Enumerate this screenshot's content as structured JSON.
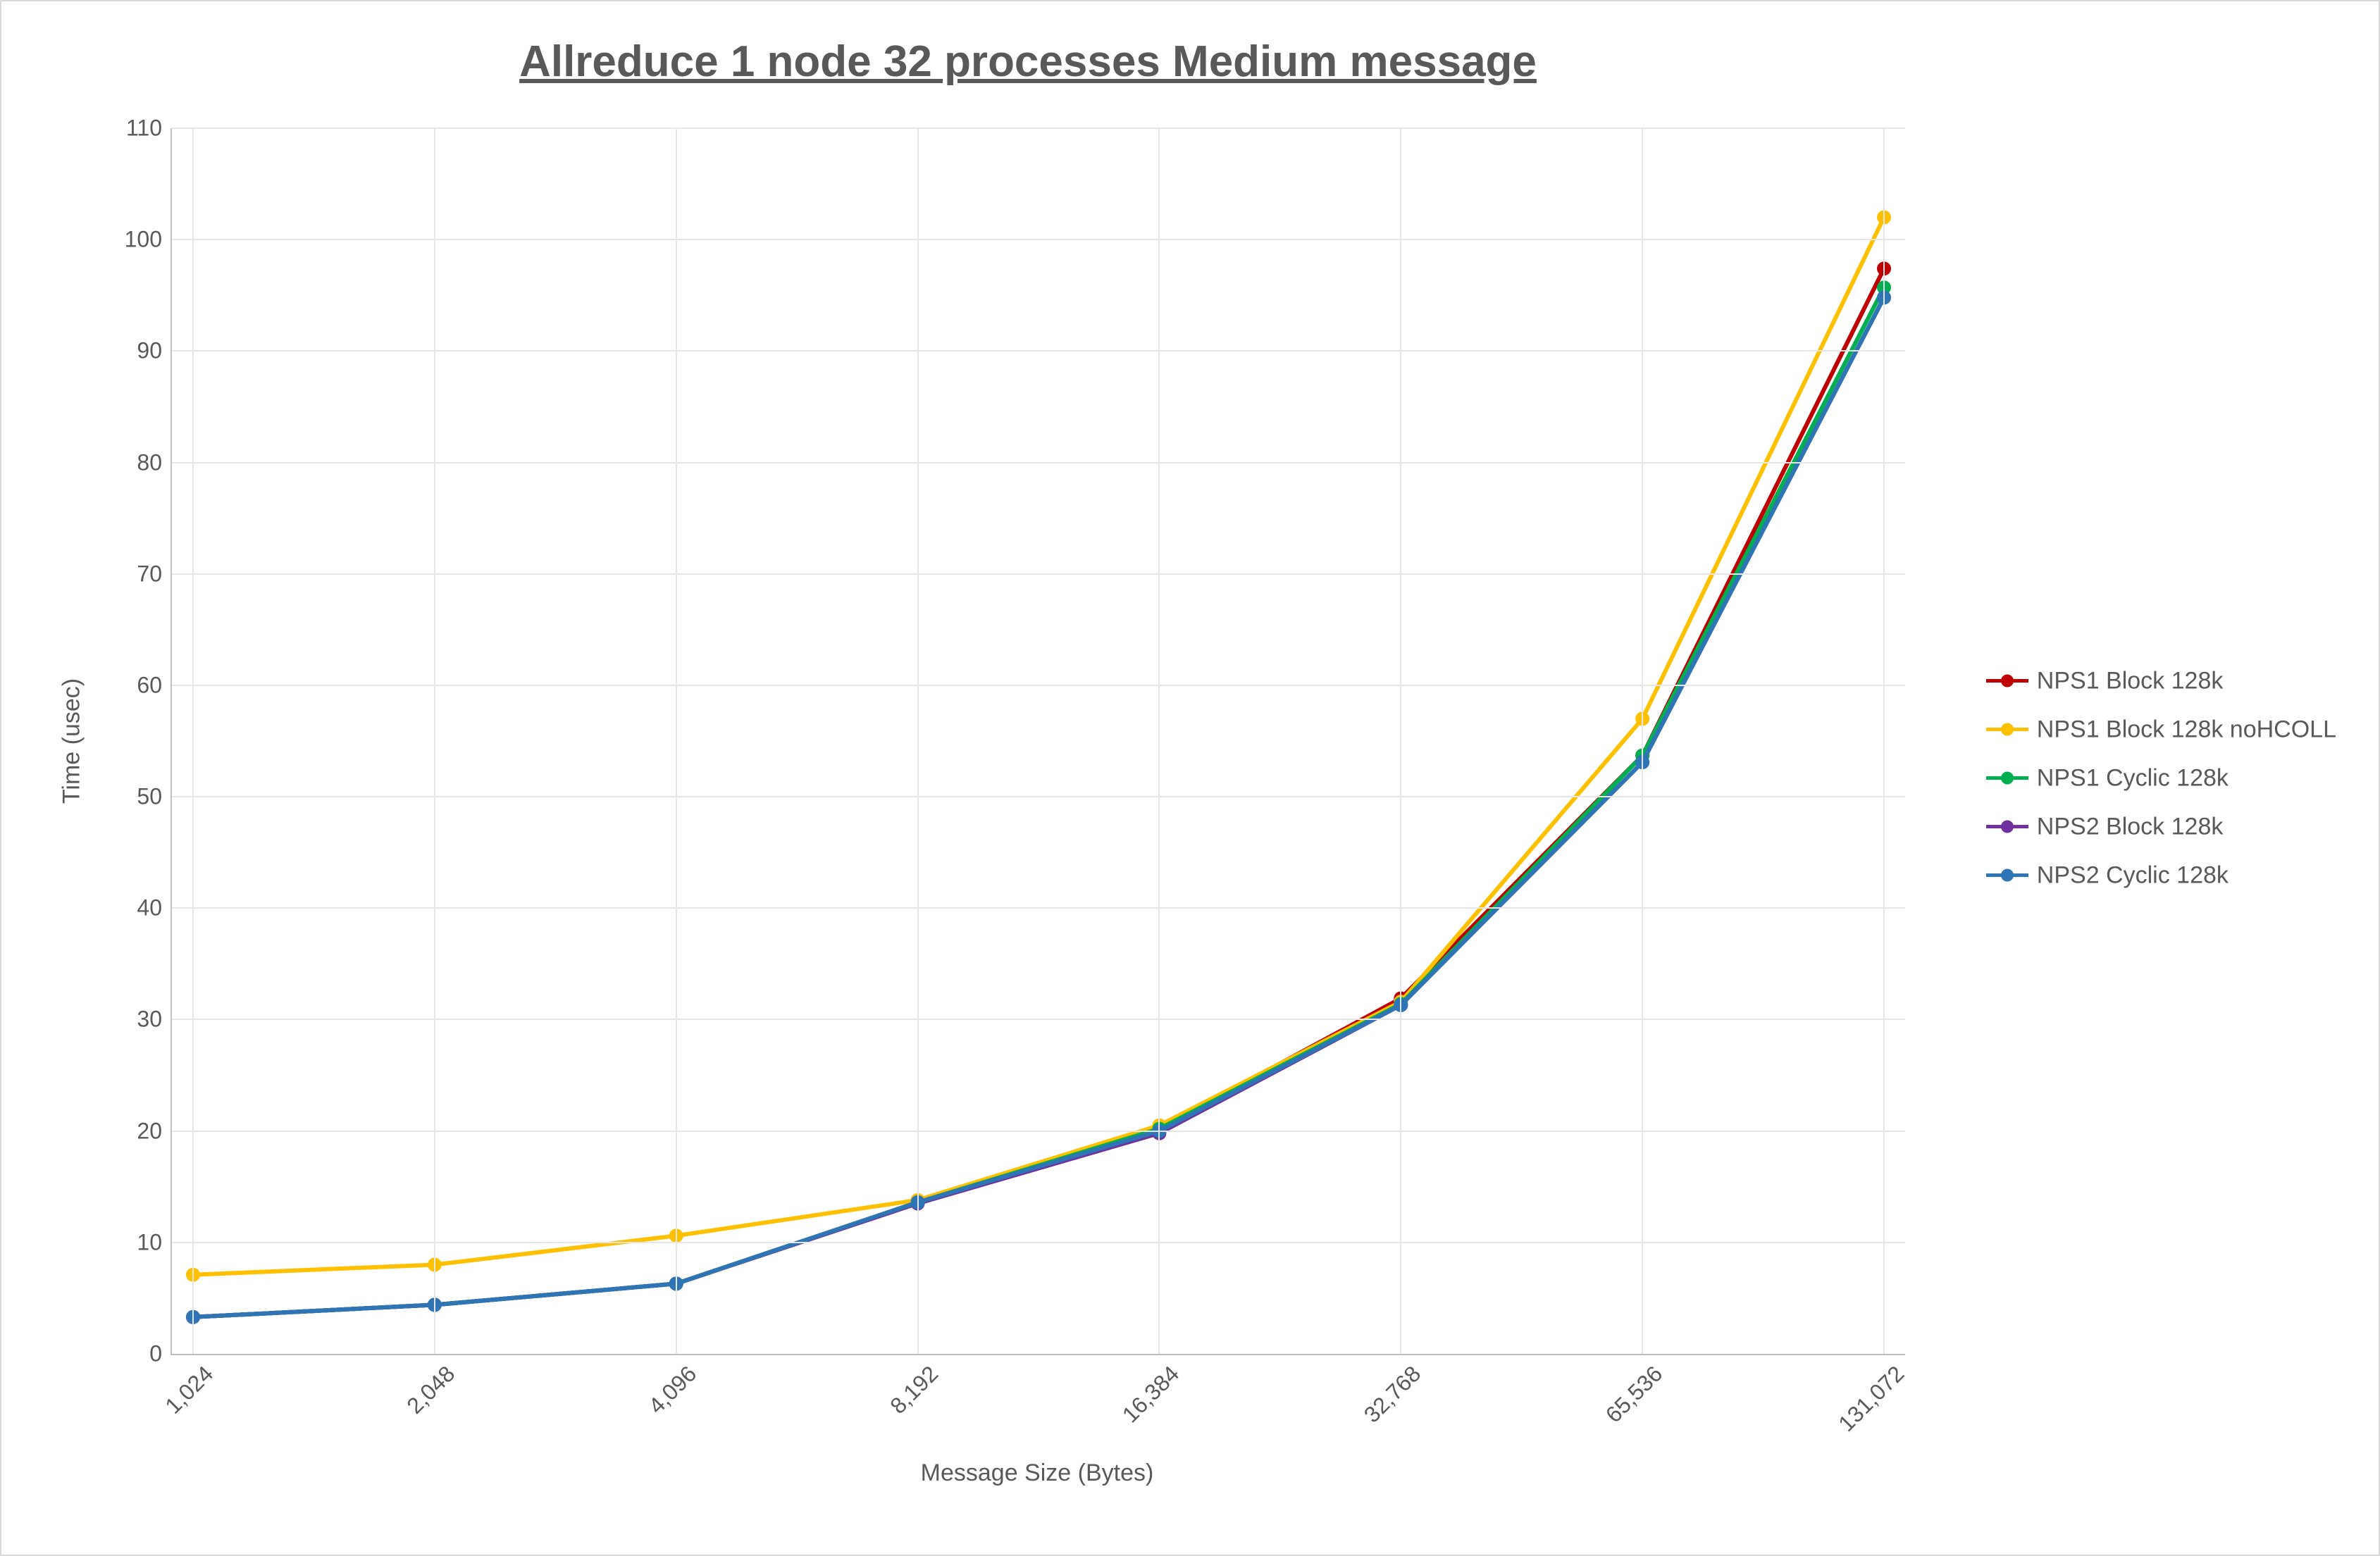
{
  "chart_data": {
    "type": "line",
    "title": "Allreduce 1 node 32 processes Medium message",
    "xlabel": "Message Size (Bytes)",
    "ylabel": "Time (usec)",
    "ylim": [
      0,
      110
    ],
    "x_scale": "log2",
    "x_values": [
      1024,
      2048,
      4096,
      8192,
      16384,
      32768,
      65536,
      131072
    ],
    "x_tick_labels": [
      "1,024",
      "2,048",
      "4,096",
      "8,192",
      "16,384",
      "32,768",
      "65,536",
      "131,072"
    ],
    "y_ticks": [
      0,
      10,
      20,
      30,
      40,
      50,
      60,
      70,
      80,
      90,
      100,
      110
    ],
    "series": [
      {
        "name": "NPS1 Block 128k",
        "color": "#C00000",
        "values": [
          3.3,
          4.4,
          6.3,
          13.6,
          20.2,
          31.9,
          53.7,
          97.4
        ]
      },
      {
        "name": "NPS1 Block 128k noHCOLL",
        "color": "#FFC000",
        "values": [
          7.1,
          8.0,
          10.6,
          13.8,
          20.5,
          31.6,
          57.0,
          102.0
        ]
      },
      {
        "name": "NPS1 Cyclic 128k",
        "color": "#00B050",
        "values": [
          3.3,
          4.4,
          6.3,
          13.6,
          20.2,
          31.4,
          53.7,
          95.7
        ]
      },
      {
        "name": "NPS2 Block 128k",
        "color": "#7030A0",
        "values": [
          3.3,
          4.4,
          6.3,
          13.5,
          19.8,
          31.3,
          53.1,
          94.8
        ]
      },
      {
        "name": "NPS2 Cyclic 128k",
        "color": "#2E75B6",
        "values": [
          3.3,
          4.4,
          6.3,
          13.6,
          20.0,
          31.3,
          53.1,
          94.8
        ]
      }
    ]
  }
}
